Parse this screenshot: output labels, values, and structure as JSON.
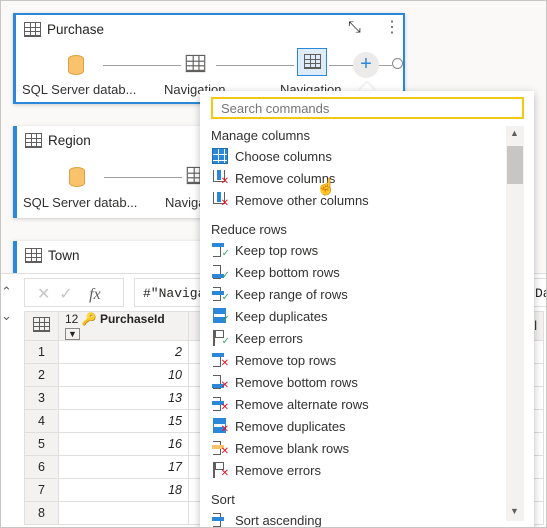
{
  "queries": [
    {
      "name": "Purchase",
      "steps": [
        "SQL Server datab...",
        "Navigation",
        "Navigation"
      ]
    },
    {
      "name": "Region",
      "steps": [
        "SQL Server datab...",
        "Naviga"
      ]
    },
    {
      "name": "Town"
    }
  ],
  "formula": {
    "fx": "fx",
    "text": "#\"Naviga",
    "right_text": "Da"
  },
  "grid": {
    "column": {
      "type": "12",
      "name": "PurchaseId"
    },
    "partial_column": "ctl",
    "rows": [
      [
        "1",
        "2"
      ],
      [
        "2",
        "10"
      ],
      [
        "3",
        "13"
      ],
      [
        "4",
        "15"
      ],
      [
        "5",
        "16"
      ],
      [
        "6",
        "17"
      ],
      [
        "7",
        "18"
      ],
      [
        "8",
        ""
      ]
    ]
  },
  "menu": {
    "search_placeholder": "Search commands",
    "sections": [
      {
        "title": "Manage columns",
        "items": [
          {
            "label": "Choose columns",
            "icon": "choose-columns-icon"
          },
          {
            "label": "Remove columns",
            "icon": "remove-columns-icon"
          },
          {
            "label": "Remove other columns",
            "icon": "remove-other-columns-icon"
          }
        ]
      },
      {
        "title": "Reduce rows",
        "items": [
          {
            "label": "Keep top rows",
            "icon": "keep-top-rows-icon"
          },
          {
            "label": "Keep bottom rows",
            "icon": "keep-bottom-rows-icon"
          },
          {
            "label": "Keep range of rows",
            "icon": "keep-range-icon"
          },
          {
            "label": "Keep duplicates",
            "icon": "keep-duplicates-icon"
          },
          {
            "label": "Keep errors",
            "icon": "keep-errors-icon"
          },
          {
            "label": "Remove top rows",
            "icon": "remove-top-rows-icon"
          },
          {
            "label": "Remove bottom rows",
            "icon": "remove-bottom-rows-icon"
          },
          {
            "label": "Remove alternate rows",
            "icon": "remove-alternate-rows-icon"
          },
          {
            "label": "Remove duplicates",
            "icon": "remove-duplicates-icon"
          },
          {
            "label": "Remove blank rows",
            "icon": "remove-blank-rows-icon"
          },
          {
            "label": "Remove errors",
            "icon": "remove-errors-icon"
          }
        ]
      },
      {
        "title": "Sort",
        "items": [
          {
            "label": "Sort ascending",
            "icon": "sort-ascending-icon"
          }
        ]
      }
    ]
  },
  "colors": {
    "accent": "#2b88d8",
    "search_border": "#f2c811",
    "check": "#3aa757",
    "cross": "#e81123"
  }
}
